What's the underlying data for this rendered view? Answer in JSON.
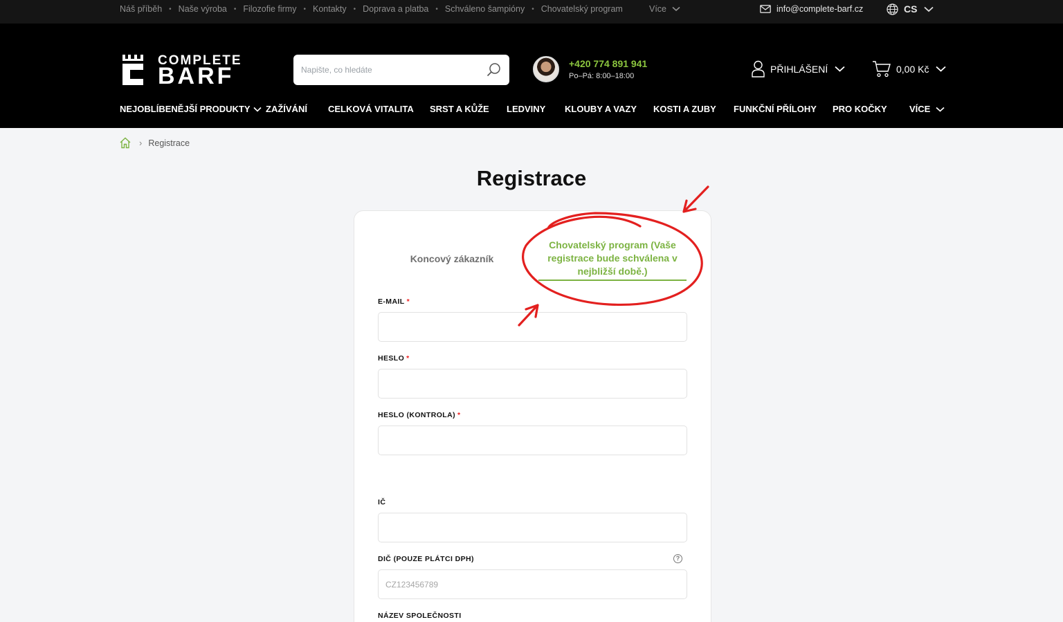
{
  "topbar": {
    "links": [
      "Náš příběh",
      "Naše výroba",
      "Filozofie firmy",
      "Kontakty",
      "Doprava a platba",
      "Schváleno šampióny",
      "Chovatelský program"
    ],
    "more": "Více",
    "email": "info@complete-barf.cz",
    "language": "CS"
  },
  "header": {
    "logo_top": "COMPLETE",
    "logo_bottom": "BARF",
    "search_placeholder": "Napište, co hledáte",
    "phone": "+420 774 891 941",
    "hours": "Po–Pá: 8:00–18:00",
    "login": "PŘIHLÁŠENÍ",
    "cart": "0,00 Kč"
  },
  "nav": {
    "items": [
      "NEJOBLÍBENĚJŠÍ PRODUKTY",
      "ZAŽÍVÁNÍ",
      "CELKOVÁ VITALITA",
      "SRST A KŮŽE",
      "LEDVINY",
      "KLOUBY A VAZY",
      "KOSTI A ZUBY",
      "FUNKČNÍ PŘÍLOHY",
      "PRO KOČKY",
      "VÍCE"
    ]
  },
  "breadcrumb": {
    "current": "Registrace"
  },
  "page": {
    "title": "Registrace"
  },
  "form": {
    "tabs": [
      "Koncový zákazník",
      "Chovatelský program  (Vaše registrace bude schválena v nejbližší době.)"
    ],
    "active_tab": 1,
    "fields": {
      "email": "E-MAIL",
      "password": "HESLO",
      "password_check": "HESLO (KONTROLA)",
      "ic": "IČ",
      "dic": "DIČ (POUZE PLÁTCI DPH)",
      "dic_placeholder": "CZ123456789",
      "company": "NÁZEV SPOLEČNOSTI"
    },
    "required_mark": "*"
  },
  "colors": {
    "accent": "#7cb342",
    "annotation": "#e3201f",
    "header_bg": "#000000"
  }
}
